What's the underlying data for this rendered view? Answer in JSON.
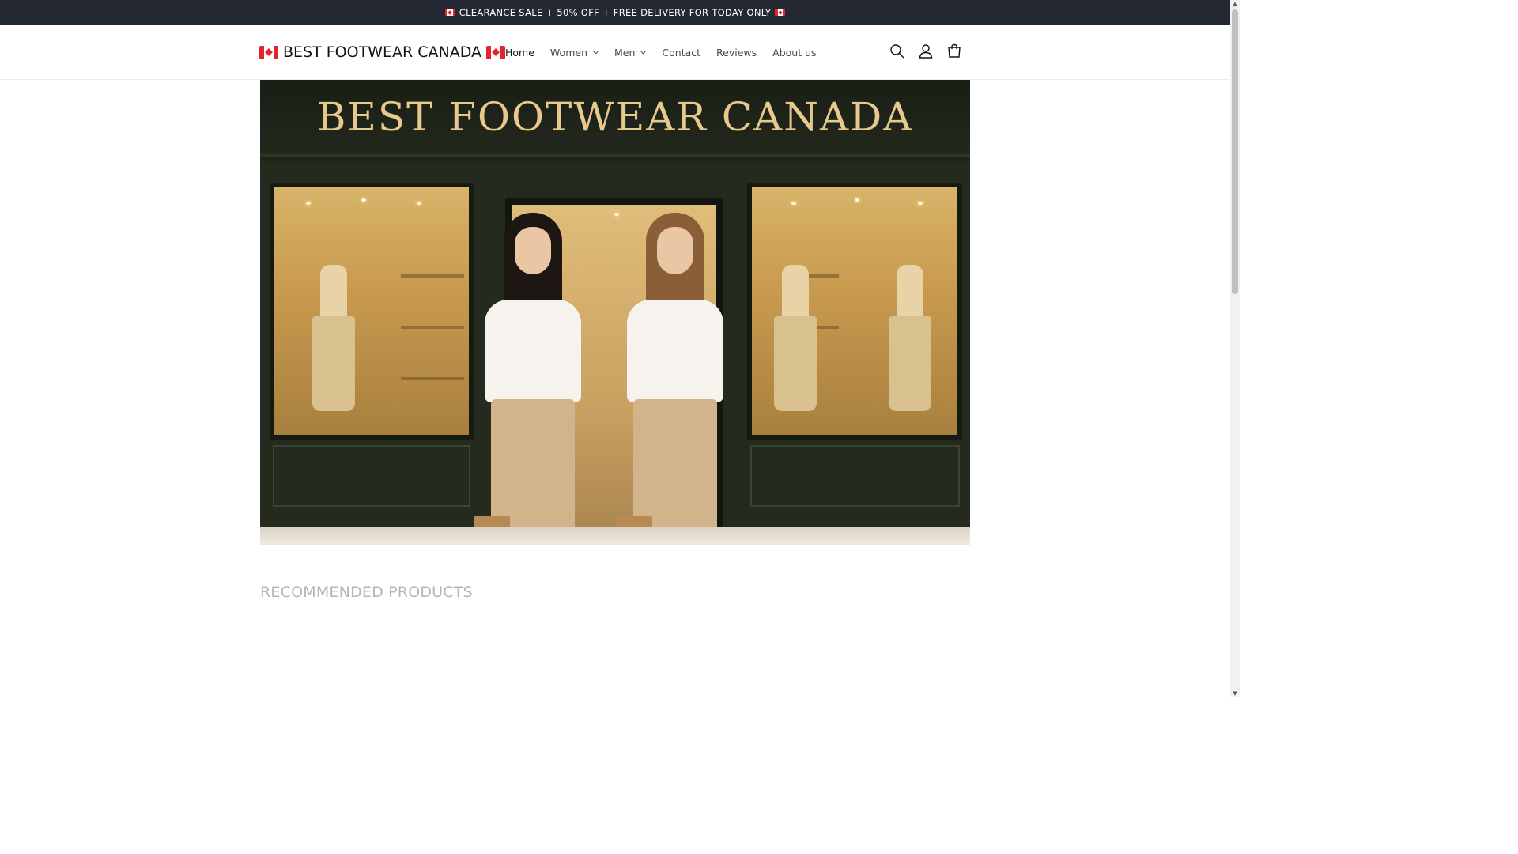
{
  "announcement": {
    "text": "CLEARANCE SALE + 50% OFF + FREE DELIVERY FOR TODAY ONLY",
    "flag_icon": "canada-flag-icon"
  },
  "header": {
    "logo_text": "BEST FOOTWEAR CANADA",
    "nav": [
      {
        "label": "Home",
        "active": true,
        "dropdown": false
      },
      {
        "label": "Women",
        "active": false,
        "dropdown": true
      },
      {
        "label": "Men",
        "active": false,
        "dropdown": true
      },
      {
        "label": "Contact",
        "active": false,
        "dropdown": false
      },
      {
        "label": "Reviews",
        "active": false,
        "dropdown": false
      },
      {
        "label": "About us",
        "active": false,
        "dropdown": false
      }
    ],
    "icons": [
      "search-icon",
      "account-icon",
      "cart-icon"
    ]
  },
  "hero": {
    "sign_text": "BEST FOOTWEAR CANADA"
  },
  "recommended": {
    "title": "RECOMMENDED PRODUCTS"
  },
  "colors": {
    "announcement_bg": "#242833",
    "sign_text": "#e7c98b",
    "section_title": "#b5b5b5"
  }
}
